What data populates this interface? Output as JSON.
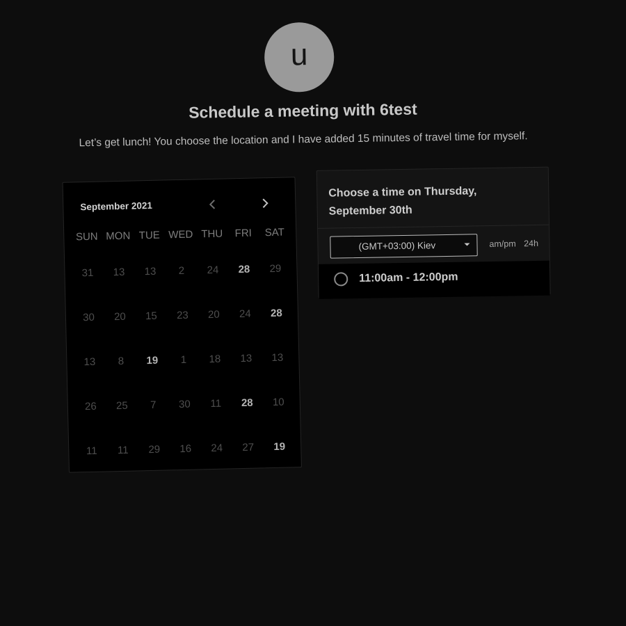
{
  "host": {
    "avatar_initial": "u",
    "title": "Schedule a meeting with 6test",
    "description": "Let’s get lunch! You choose the location and I have added 15 minutes of travel time for myself."
  },
  "calendar": {
    "month_label": "September 2021",
    "prev_icon": "chevron-left-icon",
    "next_icon": "chevron-right-icon",
    "weekdays": [
      "SUN",
      "MON",
      "TUE",
      "WED",
      "THU",
      "FRI",
      "SAT"
    ],
    "weeks": [
      [
        {
          "day": "31",
          "available": false
        },
        {
          "day": "13",
          "available": false
        },
        {
          "day": "13",
          "available": false
        },
        {
          "day": "2",
          "available": false
        },
        {
          "day": "24",
          "available": false
        },
        {
          "day": "28",
          "available": true
        },
        {
          "day": "29",
          "available": false
        }
      ],
      [
        {
          "day": "30",
          "available": false
        },
        {
          "day": "20",
          "available": false
        },
        {
          "day": "15",
          "available": false
        },
        {
          "day": "23",
          "available": false
        },
        {
          "day": "20",
          "available": false
        },
        {
          "day": "24",
          "available": false
        },
        {
          "day": "28",
          "available": true
        }
      ],
      [
        {
          "day": "13",
          "available": false
        },
        {
          "day": "8",
          "available": false
        },
        {
          "day": "19",
          "available": true
        },
        {
          "day": "1",
          "available": false
        },
        {
          "day": "18",
          "available": false
        },
        {
          "day": "13",
          "available": false
        },
        {
          "day": "13",
          "available": false
        }
      ],
      [
        {
          "day": "26",
          "available": false
        },
        {
          "day": "25",
          "available": false
        },
        {
          "day": "7",
          "available": false
        },
        {
          "day": "30",
          "available": false
        },
        {
          "day": "11",
          "available": false
        },
        {
          "day": "28",
          "available": true
        },
        {
          "day": "10",
          "available": false
        }
      ],
      [
        {
          "day": "11",
          "available": false
        },
        {
          "day": "11",
          "available": false
        },
        {
          "day": "29",
          "available": false
        },
        {
          "day": "16",
          "available": false
        },
        {
          "day": "24",
          "available": false
        },
        {
          "day": "27",
          "available": false
        },
        {
          "day": "19",
          "available": true
        }
      ]
    ]
  },
  "time_panel": {
    "heading": "Choose a time on Thursday, September 30th",
    "timezone": "(GMT+03:00) Kiev",
    "format_12h": "am/pm",
    "format_24h": "24h",
    "slots": [
      {
        "label": "11:00am - 12:00pm"
      }
    ]
  },
  "colors": {
    "background": "#0d0d0d",
    "calendar_bg": "#000000",
    "panel_bg": "#141414",
    "avatar": "#9a9a9a"
  }
}
